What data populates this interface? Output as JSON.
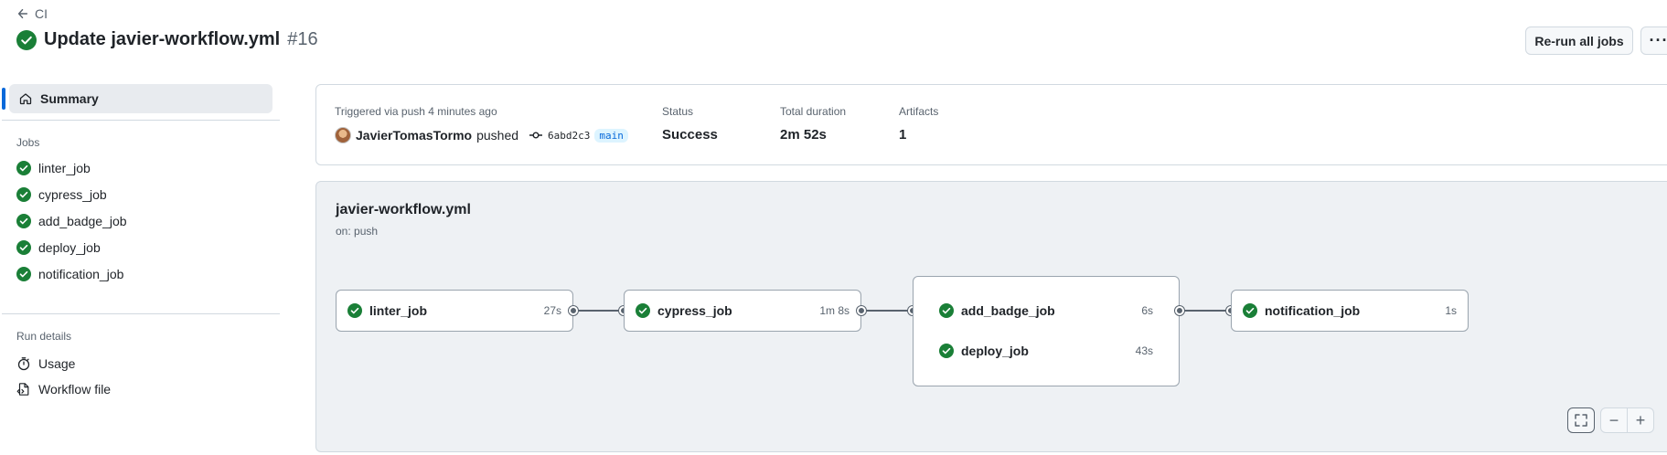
{
  "nav": {
    "back_label": "CI"
  },
  "run": {
    "title": "Update javier-workflow.yml",
    "number": "#16"
  },
  "actions": {
    "rerun_label": "Re-run all jobs",
    "more_label": "···"
  },
  "sidebar": {
    "summary_label": "Summary",
    "jobs_heading": "Jobs",
    "jobs": [
      {
        "label": "linter_job"
      },
      {
        "label": "cypress_job"
      },
      {
        "label": "add_badge_job"
      },
      {
        "label": "deploy_job"
      },
      {
        "label": "notification_job"
      }
    ],
    "run_details_heading": "Run details",
    "details": [
      {
        "label": "Usage",
        "icon": "stopwatch-icon"
      },
      {
        "label": "Workflow file",
        "icon": "file-code-icon"
      }
    ]
  },
  "info": {
    "trigger_label": "Triggered via push 4 minutes ago",
    "actor": "JavierTomasTormo",
    "pushed_text": "pushed",
    "commit_sha": "6abd2c3",
    "branch": "main",
    "status_label": "Status",
    "status_value": "Success",
    "duration_label": "Total duration",
    "duration_value": "2m 52s",
    "artifacts_label": "Artifacts",
    "artifacts_value": "1"
  },
  "graph": {
    "workflow_name": "javier-workflow.yml",
    "trigger": "on: push",
    "jobs": [
      {
        "name": "linter_job",
        "duration": "27s"
      },
      {
        "name": "cypress_job",
        "duration": "1m 8s"
      },
      {
        "name": "add_badge_job",
        "duration": "6s"
      },
      {
        "name": "deploy_job",
        "duration": "43s"
      },
      {
        "name": "notification_job",
        "duration": "1s"
      }
    ],
    "zoom_out_label": "−",
    "zoom_in_label": "+"
  },
  "colors": {
    "success": "#1a7f37",
    "accent": "#0969da",
    "muted": "#59636e",
    "panel_bg": "#eef1f4"
  }
}
